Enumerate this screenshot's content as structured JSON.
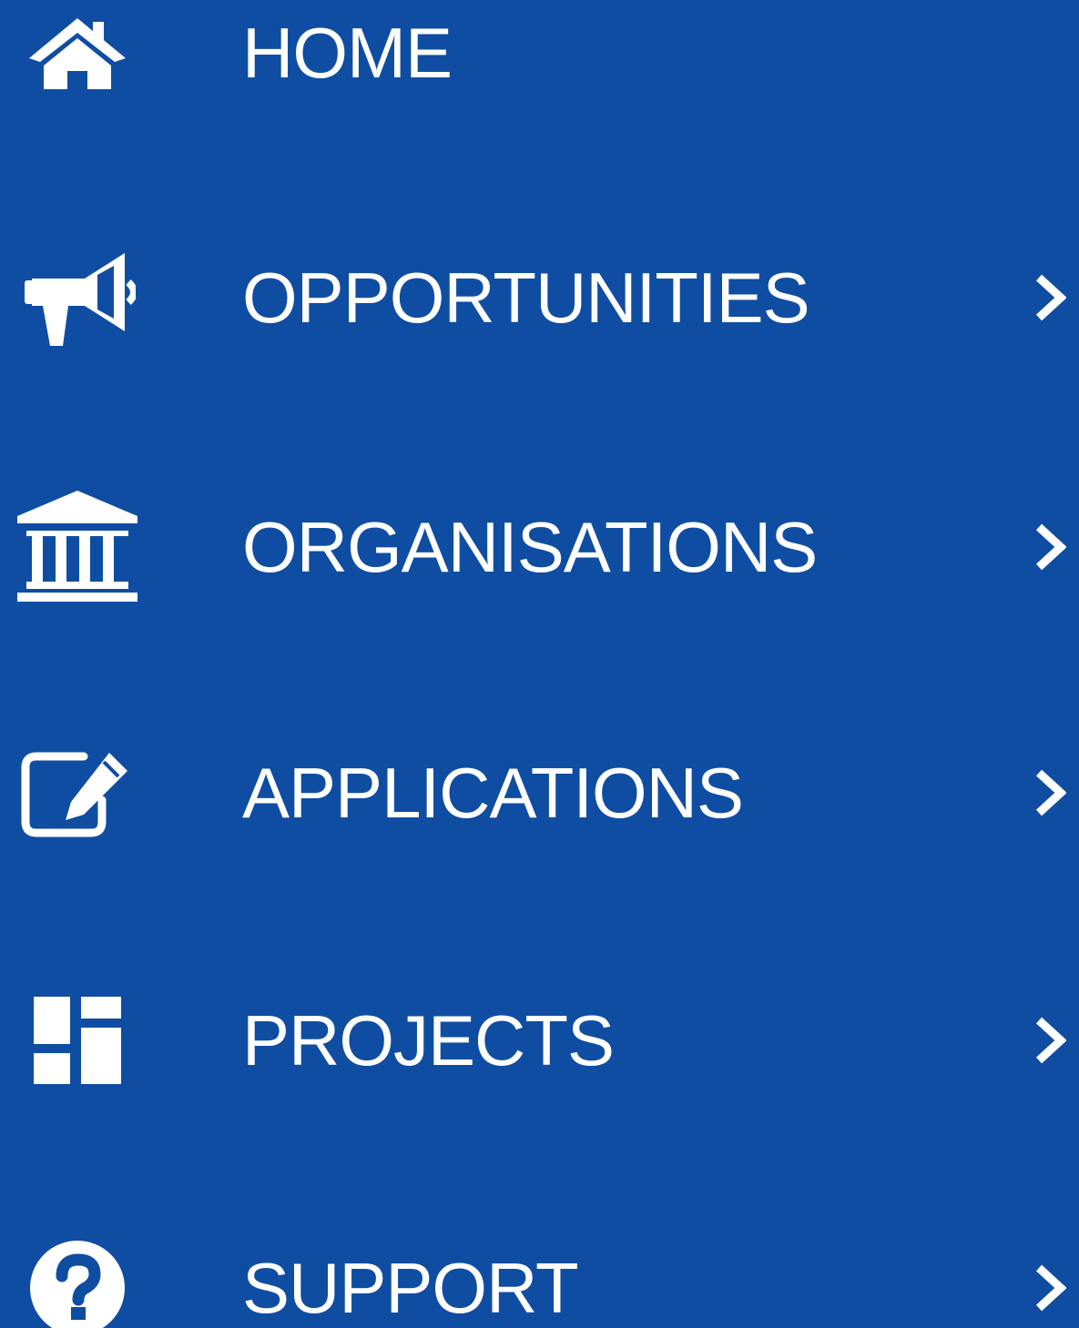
{
  "sidebar": {
    "background_color": "#0f4da2",
    "text_color": "#ffffff",
    "items": [
      {
        "label": "HOME",
        "icon": "home-icon",
        "has_submenu": false
      },
      {
        "label": "OPPORTUNITIES",
        "icon": "megaphone-icon",
        "has_submenu": true
      },
      {
        "label": "ORGANISATIONS",
        "icon": "institution-icon",
        "has_submenu": true
      },
      {
        "label": "APPLICATIONS",
        "icon": "edit-icon",
        "has_submenu": true
      },
      {
        "label": "PROJECTS",
        "icon": "dashboard-icon",
        "has_submenu": true
      },
      {
        "label": "SUPPORT",
        "icon": "question-icon",
        "has_submenu": true
      }
    ]
  }
}
